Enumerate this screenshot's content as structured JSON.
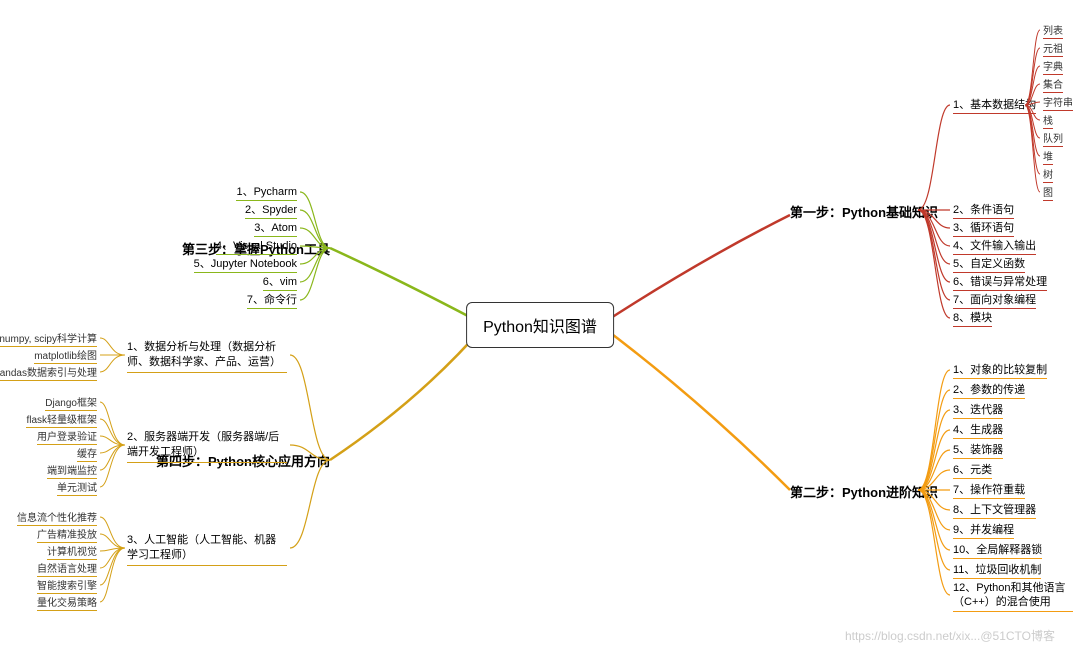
{
  "center": "Python知识图谱",
  "branches": {
    "step1": {
      "label": "第一步：Python基础知识",
      "items": [
        "1、基本数据结构",
        "2、条件语句",
        "3、循环语句",
        "4、文件输入输出",
        "5、自定义函数",
        "6、错误与异常处理",
        "7、面向对象编程",
        "8、模块"
      ],
      "structures": [
        "列表",
        "元祖",
        "字典",
        "集合",
        "字符串",
        "栈",
        "队列",
        "堆",
        "树",
        "图"
      ]
    },
    "step2": {
      "label": "第二步：Python进阶知识",
      "items": [
        "1、对象的比较复制",
        "2、参数的传递",
        "3、迭代器",
        "4、生成器",
        "5、装饰器",
        "6、元类",
        "7、操作符重载",
        "8、上下文管理器",
        "9、并发编程",
        "10、全局解释器锁",
        "11、垃圾回收机制",
        "12、Python和其他语言（C++）的混合使用"
      ]
    },
    "step3": {
      "label": "第三步：掌握Python工具",
      "items": [
        "1、Pycharm",
        "2、Spyder",
        "3、Atom",
        "4、Visual Studio",
        "5、Jupyter Notebook",
        "6、vim",
        "7、命令行"
      ]
    },
    "step4": {
      "label": "第四步：Python核心应用方向",
      "items": [
        "1、数据分析与处理（数据分析师、数据科学家、产品、运营）",
        "2、服务器端开发（服务器端/后端开发工程师）",
        "3、人工智能（人工智能、机器学习工程师）"
      ],
      "sub1": [
        "numpy, scipy科学计算",
        "matplotlib绘图",
        "pandas数据索引与处理"
      ],
      "sub2": [
        "Django框架",
        "flask轻量级框架",
        "用户登录验证",
        "缓存",
        "端到端监控",
        "单元测试"
      ],
      "sub3": [
        "信息流个性化推荐",
        "广告精准投放",
        "计算机视觉",
        "自然语言处理",
        "智能搜索引擎",
        "量化交易策略"
      ]
    }
  },
  "watermark": "https://blog.csdn.net/xix...@51CTO博客"
}
